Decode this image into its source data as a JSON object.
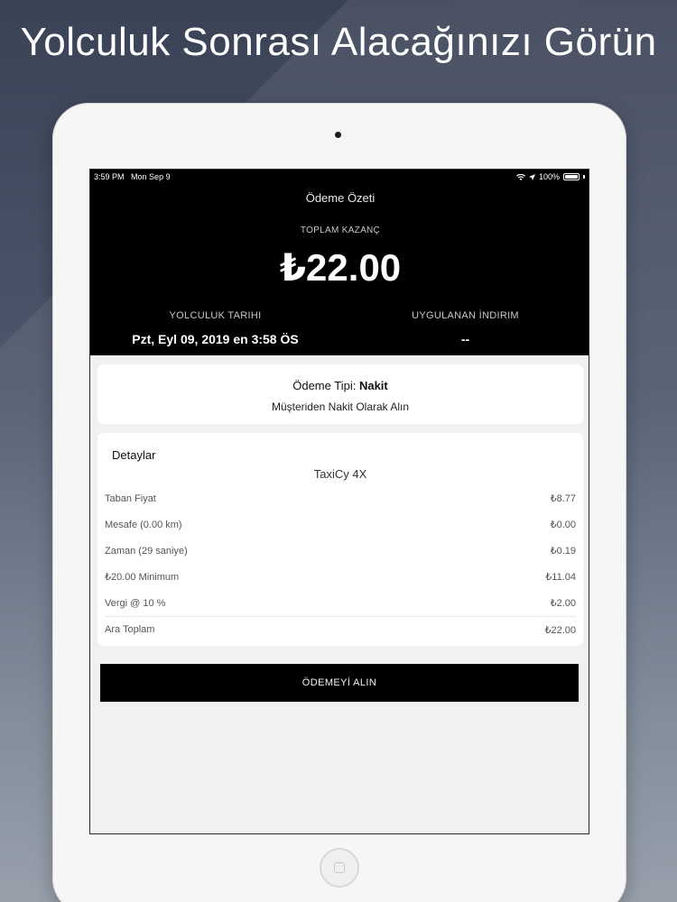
{
  "headline": "Yolculuk Sonrası Alacağınızı Görün",
  "statusbar": {
    "time": "3:59 PM",
    "date": "Mon Sep 9",
    "battery": "100%"
  },
  "summary": {
    "title": "Ödeme Özeti",
    "earnings_label": "TOPLAM KAZANÇ",
    "earnings_value": "₺22.00",
    "trip_date_label": "YOLCULUK TARIHI",
    "trip_date_value": "Pzt, Eyl 09, 2019 en 3:58 ÖS",
    "discount_label": "UYGULANAN İNDIRIM",
    "discount_value": "--"
  },
  "payment": {
    "type_label": "Ödeme Tipi:",
    "type_value": "Nakit",
    "instruction": "Müşteriden Nakit Olarak Alın"
  },
  "details": {
    "title": "Detaylar",
    "vehicle": "TaxiCy 4X",
    "rows": [
      {
        "label": "Taban Fiyat",
        "value": "₺8.77"
      },
      {
        "label": "Mesafe (0.00 km)",
        "value": "₺0.00"
      },
      {
        "label": "Zaman (29 saniye)",
        "value": "₺0.19"
      },
      {
        "label": "₺20.00 Minimum",
        "value": "₺11.04"
      },
      {
        "label": "Vergi @ 10 %",
        "value": "₺2.00"
      },
      {
        "label": "Ara Toplam",
        "value": "₺22.00"
      }
    ]
  },
  "action": {
    "collect_label": "ÖDEMEYİ ALIN"
  },
  "colors": {
    "header_bg": "#000000",
    "card_bg": "#ffffff",
    "screen_bg": "#f1f1f3"
  }
}
